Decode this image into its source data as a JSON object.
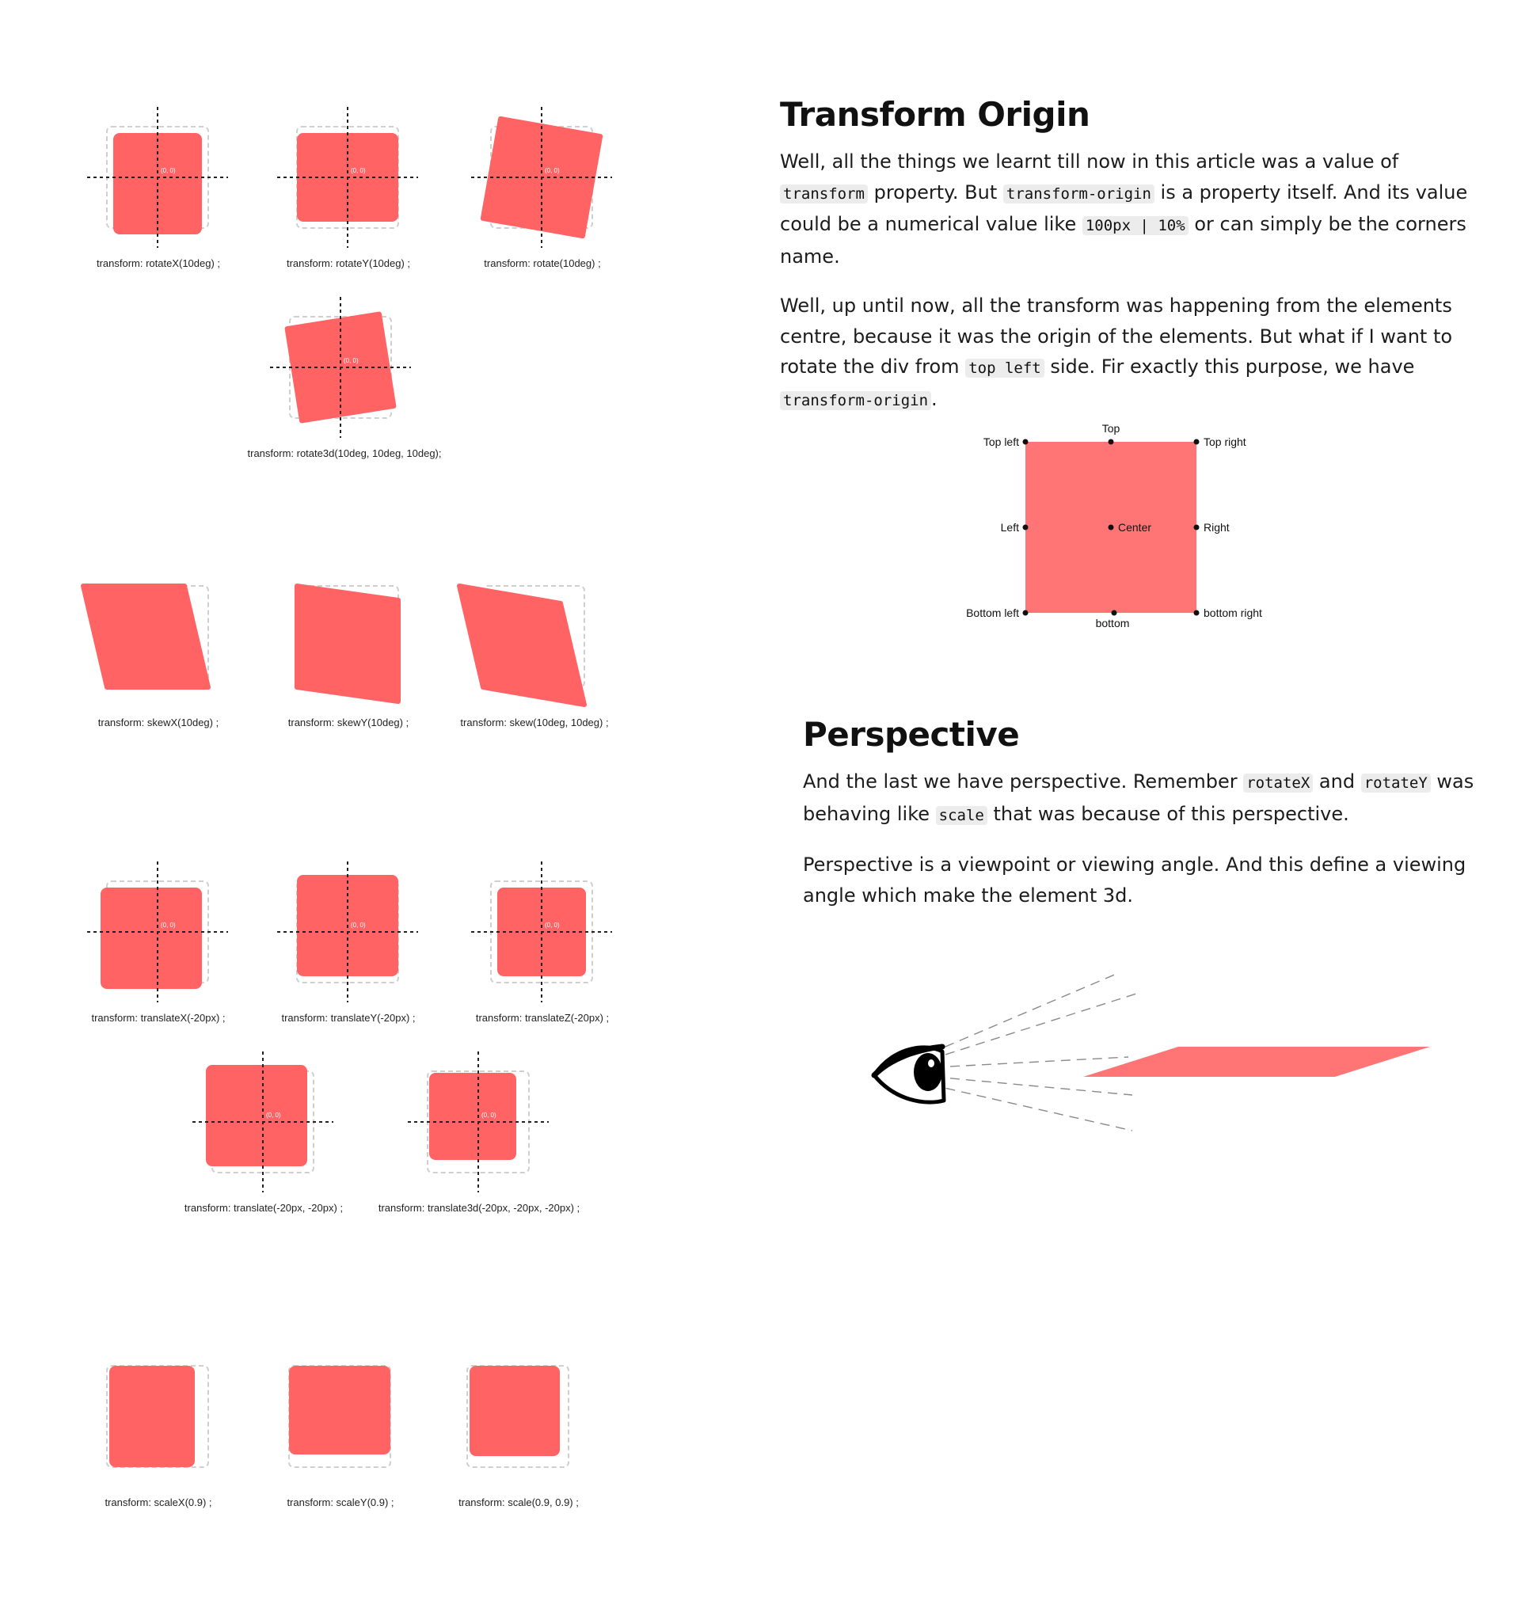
{
  "colors": {
    "box": "#ff6363",
    "origin_box": "#ff7575",
    "guide": "#cfcfcf",
    "axis": "#222222"
  },
  "demo_label": "(0, 0)",
  "rotate_demos": [
    {
      "caption": "transform: rotateX(10deg) ;"
    },
    {
      "caption": "transform: rotateY(10deg) ;"
    },
    {
      "caption": "transform: rotate(10deg) ;"
    },
    {
      "caption": "transform: rotate3d(10deg, 10deg, 10deg);"
    }
  ],
  "skew_demos": [
    {
      "caption": "transform: skewX(10deg) ;"
    },
    {
      "caption": "transform: skewY(10deg) ;"
    },
    {
      "caption": "transform: skew(10deg, 10deg) ;"
    }
  ],
  "translate_demos": [
    {
      "caption": "transform: translateX(-20px) ;"
    },
    {
      "caption": "transform: translateY(-20px) ;"
    },
    {
      "caption": "transform: translateZ(-20px) ;"
    },
    {
      "caption": "transform: translate(-20px, -20px) ;"
    },
    {
      "caption": "transform: translate3d(-20px, -20px, -20px) ;"
    }
  ],
  "scale_demos": [
    {
      "caption": "transform: scaleX(0.9) ;"
    },
    {
      "caption": "transform: scaleY(0.9) ;"
    },
    {
      "caption": "transform: scale(0.9, 0.9) ;"
    }
  ],
  "transform_origin": {
    "heading": "Transform Origin",
    "p1": {
      "t1": "Well, all the things we learnt till now in this article was a value of ",
      "c1": "transform",
      "t2": " property. But ",
      "c2": "transform-origin",
      "t3": " is a property itself. And its value could be a numerical value like ",
      "c3": "100px | 10%",
      "t4": " or can simply be the corners name."
    },
    "p2": {
      "t1": "Well, up until now, all the transform was happening from the elements centre, because it was the origin of the elements. But what if I want to rotate the div from ",
      "c1": "top left",
      "t2": " side. Fir exactly this purpose, we have ",
      "c2": "transform-origin",
      "t3": "."
    },
    "diagram": {
      "top_left": "Top left",
      "top": "Top",
      "top_right": "Top right",
      "left": "Left",
      "center": "Center",
      "right": "Right",
      "bottom_left": "Bottom left",
      "bottom": "bottom",
      "bottom_right": "bottom right"
    }
  },
  "perspective": {
    "heading": "Perspective",
    "p1": {
      "t1": "And the last we have perspective. Remember ",
      "c1": "rotateX",
      "t2": " and ",
      "c2": "rotateY",
      "t3": " was behaving like ",
      "c3": "scale",
      "t4": " that was because of this perspective."
    },
    "p2": "Perspective is a viewpoint or viewing angle. And this define a viewing angle which make the element 3d.",
    "eye_icon": "eye-icon"
  }
}
